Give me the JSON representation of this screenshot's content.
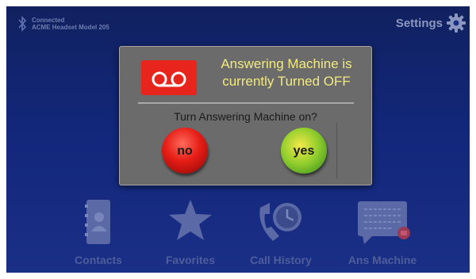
{
  "colors": {
    "background_top": "#11215f",
    "background_bottom": "#1a2f86",
    "dialog_bg": "#6b6b6b",
    "title_yellow": "#f3ea7f",
    "no_red": "#e51d16",
    "yes_green": "#7cc42a"
  },
  "status": {
    "icon": "bluetooth-icon",
    "line1": "Connected",
    "line2": "ACME Headset Model 205"
  },
  "header": {
    "settings_label": "Settings",
    "settings_icon": "gear-icon"
  },
  "tiles": [
    {
      "label": "Contacts",
      "icon": "address-book-icon"
    },
    {
      "label": "Favorites",
      "icon": "star-icon"
    },
    {
      "label": "Call History",
      "icon": "phone-clock-icon"
    },
    {
      "label": "Ans Machine",
      "icon": "answering-machine-icon"
    }
  ],
  "dialog": {
    "icon": "voicemail-icon",
    "title_line1": "Answering Machine is",
    "title_line2": "currently Turned OFF",
    "question": "Turn Answering Machine on?",
    "no_label": "no",
    "yes_label": "yes"
  }
}
